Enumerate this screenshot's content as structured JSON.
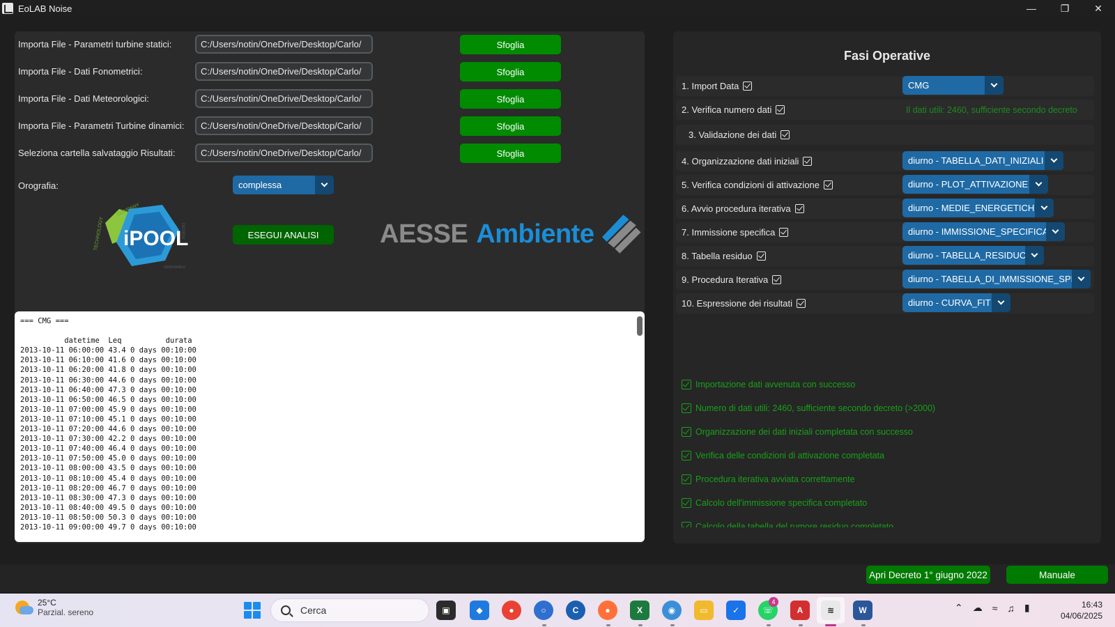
{
  "window": {
    "title": "EoLAB Noise"
  },
  "imports": [
    {
      "label": "Importa File - Parametri turbine statici:",
      "path": "C:/Users/notin/OneDrive/Desktop/Carlo/",
      "button": "Sfoglia"
    },
    {
      "label": "Importa File - Dati Fonometrici:",
      "path": "C:/Users/notin/OneDrive/Desktop/Carlo/",
      "button": "Sfoglia"
    },
    {
      "label": "Importa File - Dati Meteorologici:",
      "path": "C:/Users/notin/OneDrive/Desktop/Carlo/",
      "button": "Sfoglia"
    },
    {
      "label": "Importa File - Parametri Turbine dinamici:",
      "path": "C:/Users/notin/OneDrive/Desktop/Carlo/",
      "button": "Sfoglia"
    },
    {
      "label": "Seleziona cartella salvataggio Risultati:",
      "path": "C:/Users/notin/OneDrive/Desktop/Carlo/",
      "button": "Sfoglia"
    }
  ],
  "orografia": {
    "label": "Orografia:",
    "value": "complessa"
  },
  "run_button": "ESEGUI ANALISI",
  "logos": {
    "ipool_text": "iPOOL",
    "ipool_top": "COMPANY",
    "ipool_left": "TECHNOLOGY",
    "aesse": "AESSE",
    "ambiente": "Ambiente"
  },
  "console": {
    "header": "=== CMG ===",
    "columns": "          datetime  Leq          durata",
    "rows": [
      "2013-10-11 06:00:00 43.4 0 days 00:10:00",
      "2013-10-11 06:10:00 41.6 0 days 00:10:00",
      "2013-10-11 06:20:00 41.8 0 days 00:10:00",
      "2013-10-11 06:30:00 44.6 0 days 00:10:00",
      "2013-10-11 06:40:00 47.3 0 days 00:10:00",
      "2013-10-11 06:50:00 46.5 0 days 00:10:00",
      "2013-10-11 07:00:00 45.9 0 days 00:10:00",
      "2013-10-11 07:10:00 45.1 0 days 00:10:00",
      "2013-10-11 07:20:00 44.6 0 days 00:10:00",
      "2013-10-11 07:30:00 42.2 0 days 00:10:00",
      "2013-10-11 07:40:00 46.4 0 days 00:10:00",
      "2013-10-11 07:50:00 45.0 0 days 00:10:00",
      "2013-10-11 08:00:00 43.5 0 days 00:10:00",
      "2013-10-11 08:10:00 45.4 0 days 00:10:00",
      "2013-10-11 08:20:00 46.7 0 days 00:10:00",
      "2013-10-11 08:30:00 47.3 0 days 00:10:00",
      "2013-10-11 08:40:00 49.5 0 days 00:10:00",
      "2013-10-11 08:50:00 50.3 0 days 00:10:00",
      "2013-10-11 09:00:00 49.7 0 days 00:10:00"
    ]
  },
  "fasi": {
    "title": "Fasi Operative",
    "steps": [
      {
        "label": "1. Import Data",
        "combo": "CMG"
      },
      {
        "label": "2. Verifica numero dati",
        "info": "Il dati utili: 2460, sufficiente secondo decreto"
      },
      {
        "label": "3. Validazione dei dati"
      },
      {
        "label": "4. Organizzazione dati iniziali",
        "combo": "diurno - TABELLA_DATI_INIZIALI"
      },
      {
        "label": "5. Verifica condizioni di attivazione",
        "combo": "diurno - PLOT_ATTIVAZIONE"
      },
      {
        "label": "6. Avvio procedura iterativa",
        "combo": "diurno - MEDIE_ENERGETICHE"
      },
      {
        "label": "7. Immissione specifica",
        "combo": "diurno - IMMISSIONE_SPECIFICA"
      },
      {
        "label": "8. Tabella residuo",
        "combo": "diurno - TABELLA_RESIDUO"
      },
      {
        "label": "9. Procedura Iterativa",
        "combo": "diurno - TABELLA_DI_IMMISSIONE_SPE"
      },
      {
        "label": "10. Espressione dei risultati",
        "combo": "diurno - CURVA_FIT"
      }
    ]
  },
  "log": [
    "Importazione dati avvenuta con successo",
    "Numero di dati utili: 2460, sufficiente secondo decreto (>2000)",
    "Organizzazione dei dati iniziali completata con successo",
    "Verifica delle condizioni di attivazione completata",
    "Procedura iterativa avviata correttamente",
    "Calcolo dell'immissione specifica completato",
    "Calcolo della tabella del rumore residuo completato"
  ],
  "footer": {
    "decreto": "Apri Decreto 1° giugno 2022",
    "manuale": "Manuale"
  },
  "taskbar": {
    "weather_temp": "25°C",
    "weather_desc": "Parzial. sereno",
    "search": "Cerca",
    "whatsapp_badge": "4",
    "time": "16:43",
    "date": "04/06/2025"
  },
  "colors": {
    "accent_green": "#008b00",
    "combo_blue": "#1f6aa5",
    "success_green": "#19a019"
  }
}
